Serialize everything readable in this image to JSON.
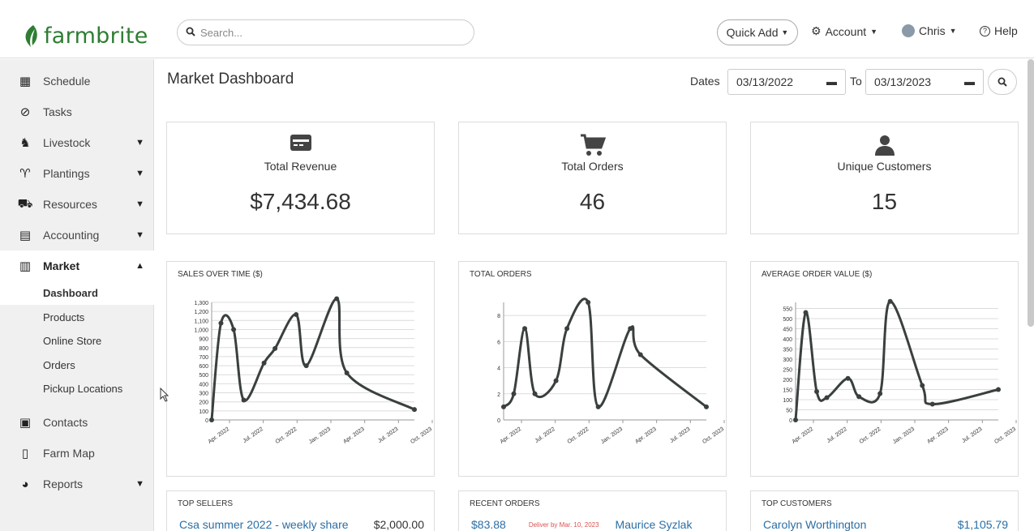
{
  "brand": {
    "name": "farmbrite",
    "color": "#2f7d33"
  },
  "topbar": {
    "search_placeholder": "Search...",
    "quick_add": "Quick Add",
    "account": "Account",
    "user": "Chris",
    "help": "Help"
  },
  "sidebar": {
    "items": [
      {
        "label": "Schedule",
        "icon": "calendar-icon"
      },
      {
        "label": "Tasks",
        "icon": "check-circle-icon"
      },
      {
        "label": "Livestock",
        "icon": "horse-icon",
        "expandable": true
      },
      {
        "label": "Plantings",
        "icon": "seedling-icon",
        "expandable": true
      },
      {
        "label": "Resources",
        "icon": "tractor-icon",
        "expandable": true
      },
      {
        "label": "Accounting",
        "icon": "calculator-icon",
        "expandable": true
      },
      {
        "label": "Market",
        "icon": "store-icon",
        "expanded": true
      },
      {
        "label": "Contacts",
        "icon": "contact-card-icon"
      },
      {
        "label": "Farm Map",
        "icon": "map-icon"
      },
      {
        "label": "Reports",
        "icon": "pie-chart-icon",
        "expandable": true
      }
    ],
    "market_sub": [
      "Dashboard",
      "Products",
      "Online Store",
      "Orders",
      "Pickup Locations"
    ]
  },
  "main": {
    "title": "Market Dashboard",
    "dates_label": "Dates",
    "date_from": "03/13/2022",
    "to_label": "To",
    "date_to": "03/13/2023"
  },
  "stats": [
    {
      "label": "Total Revenue",
      "value": "$7,434.68",
      "icon": "credit-card-icon"
    },
    {
      "label": "Total Orders",
      "value": "46",
      "icon": "cart-icon"
    },
    {
      "label": "Unique Customers",
      "value": "15",
      "icon": "user-icon"
    }
  ],
  "chart_data": [
    {
      "type": "line",
      "title": "SALES OVER TIME ($)",
      "x": [
        "Apr. 2022",
        "Jul. 2022",
        "Oct. 2022",
        "Jan. 2023",
        "Apr. 2023",
        "Jul. 2023",
        "Oct. 2023"
      ],
      "yticks": [
        0,
        100,
        200,
        300,
        400,
        500,
        600,
        700,
        800,
        900,
        1000,
        1100,
        1200,
        1300
      ],
      "ylim": [
        0,
        1300
      ],
      "points": [
        {
          "t": 0.0,
          "y": 0
        },
        {
          "t": 0.11,
          "y": 1070
        },
        {
          "t": 0.26,
          "y": 1000
        },
        {
          "t": 0.38,
          "y": 220
        },
        {
          "t": 0.62,
          "y": 630
        },
        {
          "t": 0.75,
          "y": 790
        },
        {
          "t": 1.0,
          "y": 1165
        },
        {
          "t": 1.12,
          "y": 600
        },
        {
          "t": 1.48,
          "y": 1340
        },
        {
          "t": 1.6,
          "y": 520
        },
        {
          "t": 2.4,
          "y": 115
        }
      ]
    },
    {
      "type": "line",
      "title": "TOTAL ORDERS",
      "x": [
        "Apr. 2022",
        "Jul. 2022",
        "Oct. 2022",
        "Jan. 2023",
        "Apr. 2023",
        "Jul. 2023",
        "Oct. 2023"
      ],
      "yticks": [
        0,
        2,
        4,
        6,
        8
      ],
      "ylim": [
        0,
        9
      ],
      "points": [
        {
          "t": 0.0,
          "y": 1
        },
        {
          "t": 0.12,
          "y": 2
        },
        {
          "t": 0.25,
          "y": 7
        },
        {
          "t": 0.37,
          "y": 2
        },
        {
          "t": 0.62,
          "y": 3
        },
        {
          "t": 0.75,
          "y": 7
        },
        {
          "t": 1.0,
          "y": 9
        },
        {
          "t": 1.12,
          "y": 1
        },
        {
          "t": 1.5,
          "y": 7
        },
        {
          "t": 1.62,
          "y": 5
        },
        {
          "t": 2.4,
          "y": 1
        }
      ]
    },
    {
      "type": "line",
      "title": "AVERAGE ORDER VALUE ($)",
      "x": [
        "Apr. 2022",
        "Jul. 2022",
        "Oct. 2022",
        "Jan. 2023",
        "Apr. 2023",
        "Jul. 2023",
        "Oct. 2023"
      ],
      "yticks": [
        0,
        50,
        100,
        150,
        200,
        250,
        300,
        350,
        400,
        450,
        500,
        550
      ],
      "ylim": [
        0,
        580
      ],
      "points": [
        {
          "t": 0.0,
          "y": 0
        },
        {
          "t": 0.12,
          "y": 530
        },
        {
          "t": 0.25,
          "y": 140
        },
        {
          "t": 0.37,
          "y": 110
        },
        {
          "t": 0.62,
          "y": 205
        },
        {
          "t": 0.75,
          "y": 115
        },
        {
          "t": 1.0,
          "y": 130
        },
        {
          "t": 1.12,
          "y": 585
        },
        {
          "t": 1.5,
          "y": 170
        },
        {
          "t": 1.62,
          "y": 78
        },
        {
          "t": 2.4,
          "y": 150
        }
      ]
    }
  ],
  "lists": {
    "top_sellers": {
      "title": "TOP SELLERS",
      "name": "Csa summer 2022 - weekly share",
      "amount": "$2,000.00"
    },
    "recent_orders": {
      "title": "RECENT ORDERS",
      "amount": "$83.88",
      "note": "Deliver by Mar. 10, 2023",
      "customer": "Maurice Syzlak"
    },
    "top_customers": {
      "title": "TOP CUSTOMERS",
      "name": "Carolyn Worthington",
      "amount": "$1,105.79"
    }
  },
  "colors": {
    "link": "#2a6ea5",
    "line": "#3a3f3f",
    "deliver_note": "#d9534f"
  }
}
